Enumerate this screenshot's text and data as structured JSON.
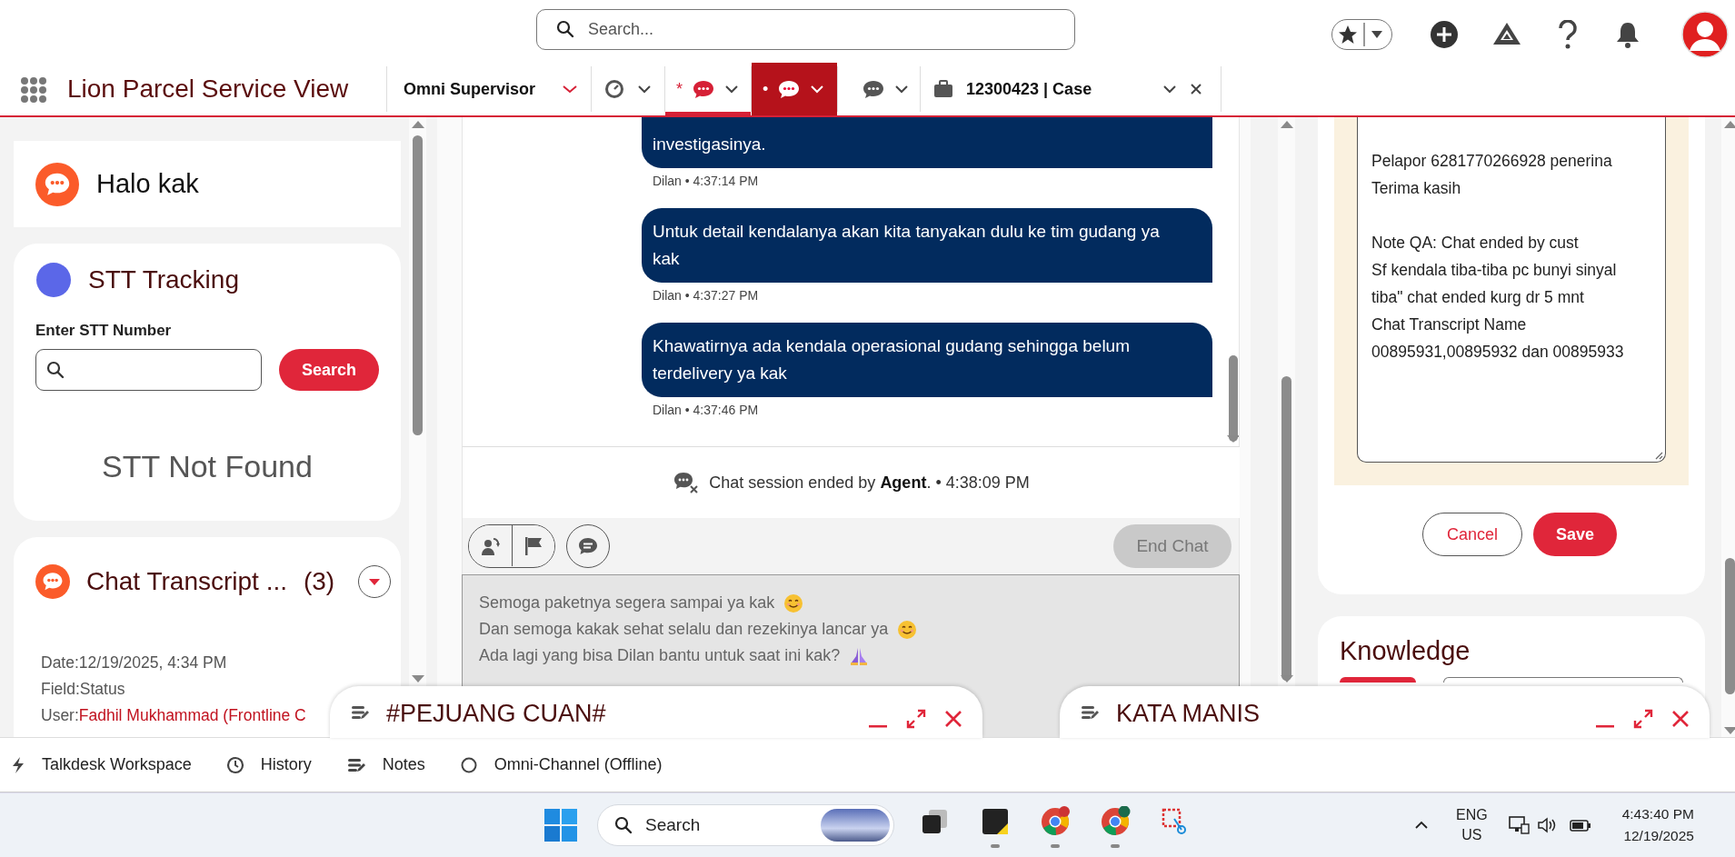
{
  "header": {
    "search_placeholder": "Search..."
  },
  "app": {
    "title": "Lion Parcel Service View"
  },
  "tabs": [
    {
      "kind": "nav",
      "label": "Omni Supervisor",
      "selected": false,
      "highlighted": false
    },
    {
      "kind": "status",
      "selected": false,
      "highlighted": false
    },
    {
      "kind": "chat",
      "mark": "*",
      "selected": true,
      "highlighted": false
    },
    {
      "kind": "chat",
      "mark": "•",
      "selected": false,
      "highlighted": true
    },
    {
      "kind": "chat",
      "selected": false,
      "highlighted": false
    },
    {
      "kind": "record",
      "label": "12300423 | Case",
      "selected": false,
      "highlighted": false
    }
  ],
  "left": {
    "greeting": "Halo kak",
    "stt": {
      "title": "STT Tracking",
      "field_label": "Enter STT Number",
      "button": "Search",
      "result": "STT Not Found"
    },
    "transcripts": {
      "title": "Chat Transcript ...",
      "count": "(3)",
      "details": [
        {
          "label": "Date:",
          "value": "12/19/2025, 4:34 PM",
          "link": false
        },
        {
          "label": "Field:",
          "value": "Status",
          "link": false
        },
        {
          "label": "User:",
          "value": "Fadhil Mukhammad (Frontline C",
          "link": true
        }
      ]
    }
  },
  "chat": {
    "messages": [
      {
        "text": "investigasinya.",
        "meta": "Dilan • 4:37:14 PM"
      },
      {
        "text": "Untuk detail kendalanya akan kita tanyakan dulu ke tim gudang ya kak",
        "meta": "Dilan • 4:37:27 PM"
      },
      {
        "text": "Khawatirnya ada kendala operasional gudang sehingga belum terdelivery ya kak",
        "meta": "Dilan • 4:37:46 PM"
      }
    ],
    "session_event": "Chat session ended by **Agent**. • 4:38:09 PM",
    "end_button": {
      "label": "End Chat",
      "disabled": true
    },
    "composer_lines": [
      {
        "text": "Semoga paketnya segera sampai ya kak",
        "kind": "smile"
      },
      {
        "text": "Dan semoga kakak sehat selalu dan rezekinya lancar ya",
        "kind": "smile"
      },
      {
        "text": "Ada lagi yang bisa Dilan bantu untuk saat ini kak?",
        "kind": "pray"
      }
    ]
  },
  "right": {
    "notes": "Pelapor 6281770266928 penerina\nTerima kasih\n\nNote QA: Chat ended by cust\nSf kendala tiba-tiba pc bunyi sinyal tiba\" chat ended kurg dr 5 mnt\nChat Transcript Name\n00895931,00895932 dan 00895933",
    "cancel": "Cancel",
    "save": "Save",
    "knowledge_title": "Knowledge"
  },
  "docked_panels": [
    {
      "title": "#PEJUANG CUAN#"
    },
    {
      "title": "KATA MANIS"
    }
  ],
  "utility_bar": [
    {
      "kind": "bolt",
      "label": "Talkdesk Workspace"
    },
    {
      "kind": "clock",
      "label": "History"
    },
    {
      "kind": "notes",
      "label": "Notes"
    },
    {
      "kind": "presence",
      "label": "Omni-Channel (Offline)"
    }
  ],
  "taskbar": {
    "search": "Search",
    "language": "ENG",
    "region": "US",
    "time": "4:43:40 PM",
    "date": "12/19/2025"
  }
}
